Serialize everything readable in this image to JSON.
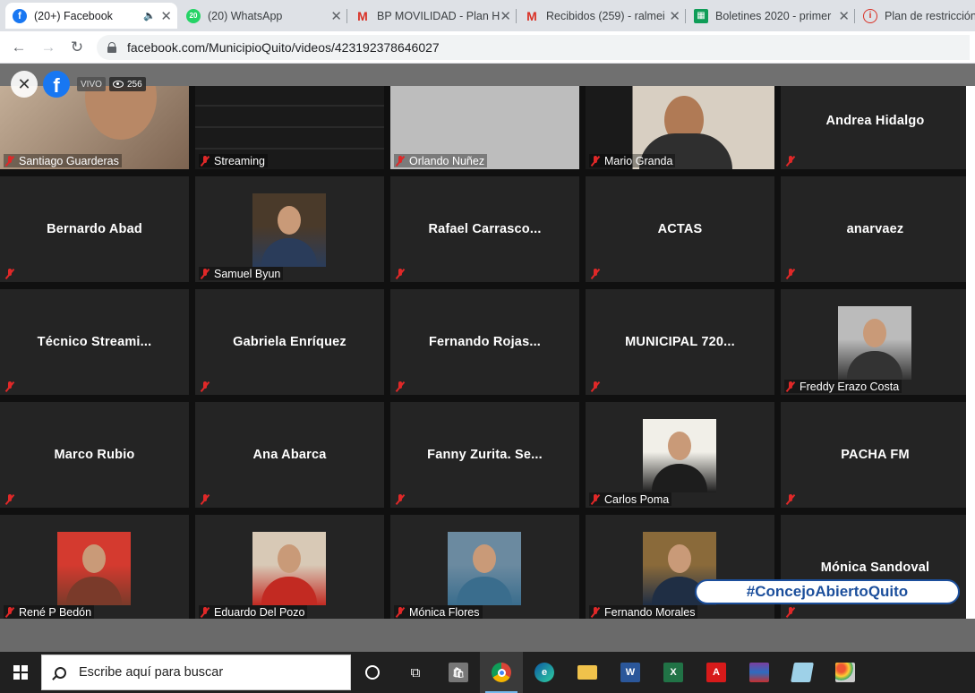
{
  "tabs": [
    {
      "title": "(20+) Facebook",
      "favicon": "facebook-icon",
      "active": true,
      "audio": true
    },
    {
      "title": "(20) WhatsApp",
      "favicon": "whatsapp-icon",
      "badge": "20"
    },
    {
      "title": "BP MOVILIDAD - Plan H",
      "favicon": "gmail-icon"
    },
    {
      "title": "Recibidos (259) - ralmei",
      "favicon": "gmail-icon"
    },
    {
      "title": "Boletines 2020 - primer",
      "favicon": "sheets-icon"
    },
    {
      "title": "Plan de restricción",
      "favicon": "info-icon"
    }
  ],
  "address_bar": {
    "url": "facebook.com/MunicipioQuito/videos/423192378646027"
  },
  "video": {
    "live_label": "VIVO",
    "viewer_count": "256",
    "hashtag": "#ConcejoAbiertoQuito",
    "participants": [
      {
        "name": "Santiago Guarderas",
        "video": true
      },
      {
        "name": "Streaming",
        "video": true
      },
      {
        "name": "Orlando Nuñez",
        "video": true
      },
      {
        "name": "Mario Granda",
        "video": true
      },
      {
        "name": "Andrea Hidalgo",
        "video": false
      },
      {
        "name": "Bernardo Abad",
        "video": false
      },
      {
        "name": "Samuel Byun",
        "video": true
      },
      {
        "name": "Rafael  Carrasco...",
        "video": false
      },
      {
        "name": "ACTAS",
        "video": false
      },
      {
        "name": "anarvaez",
        "video": false
      },
      {
        "name": "Técnico  Streami...",
        "video": false
      },
      {
        "name": "Gabriela Enríquez",
        "video": false
      },
      {
        "name": "Fernando  Rojas...",
        "video": false
      },
      {
        "name": "MUNICIPAL  720...",
        "video": false
      },
      {
        "name": "Freddy Erazo Costa",
        "video": true
      },
      {
        "name": "Marco Rubio",
        "video": false
      },
      {
        "name": "Ana Abarca",
        "video": false
      },
      {
        "name": "Fanny  Zurita. Se...",
        "video": false
      },
      {
        "name": "Carlos Poma",
        "video": true
      },
      {
        "name": "PACHA FM",
        "video": false
      },
      {
        "name": "René P Bedón",
        "video": true
      },
      {
        "name": "Eduardo Del Pozo",
        "video": true
      },
      {
        "name": "Mónica Flores",
        "video": true
      },
      {
        "name": "Fernando Morales",
        "video": true
      },
      {
        "name": "Mónica Sandoval",
        "video": false
      }
    ]
  },
  "taskbar": {
    "search_placeholder": "Escribe aquí para buscar",
    "apps": [
      "task-view-icon",
      "store-icon",
      "chrome-icon",
      "edge-icon",
      "file-explorer-icon",
      "word-icon",
      "excel-icon",
      "acrobat-icon",
      "winrar-icon",
      "notes-icon",
      "paint-icon"
    ]
  },
  "colors": {
    "facebook": "#1877f2",
    "tile_bg": "#242424",
    "mute": "#e02828",
    "taskbar": "#202020"
  }
}
